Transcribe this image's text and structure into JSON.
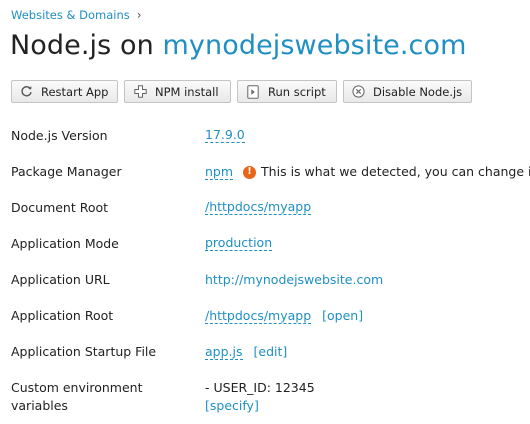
{
  "breadcrumb": {
    "item": "Websites & Domains",
    "separator": "›"
  },
  "title": {
    "prefix": "Node.js on ",
    "domain": "mynodejswebsite.com"
  },
  "toolbar": {
    "restart_label": "Restart App",
    "npm_label": "NPM install",
    "run_label": "Run script",
    "disable_label": "Disable Node.js"
  },
  "settings": {
    "nodejs_version": {
      "label": "Node.js Version",
      "value": "17.9.0"
    },
    "package_manager": {
      "label": "Package Manager",
      "value": "npm",
      "note": "This is what we detected, you can change it"
    },
    "document_root": {
      "label": "Document Root",
      "value": "/httpdocs/myapp"
    },
    "application_mode": {
      "label": "Application Mode",
      "value": "production"
    },
    "application_url": {
      "label": "Application URL",
      "value": "http://mynodejswebsite.com"
    },
    "application_root": {
      "label": "Application Root",
      "value": "/httpdocs/myapp",
      "action": "[open]"
    },
    "startup_file": {
      "label": "Application Startup File",
      "value": "app.js",
      "action": "[edit]"
    },
    "env_vars": {
      "label": "Custom environment variables",
      "value": "- USER_ID: 12345",
      "action": "[specify]"
    }
  },
  "colors": {
    "link": "#1f8fc4",
    "warning": "#e8651a"
  }
}
